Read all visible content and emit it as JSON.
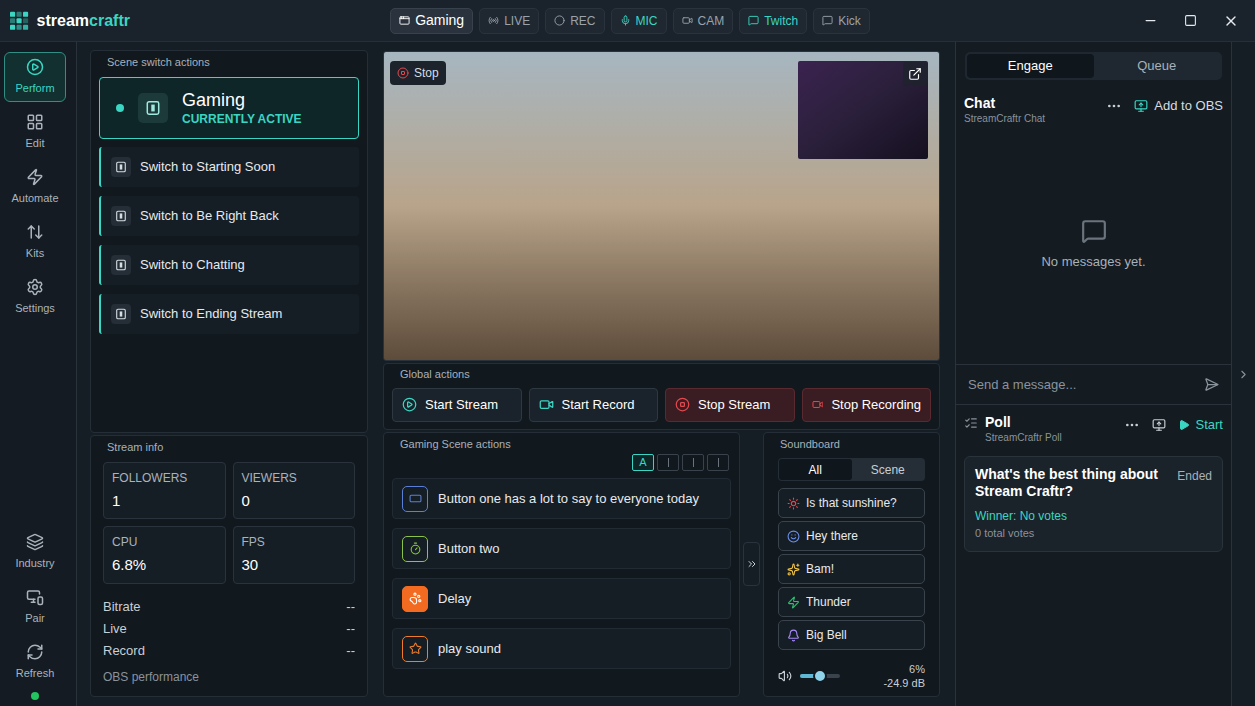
{
  "window": {
    "logo": {
      "prefix": "stream",
      "suffix": "craftr"
    }
  },
  "topbar": {
    "pills": [
      {
        "label": "Gaming",
        "selected": true,
        "on": true
      },
      {
        "label": "LIVE",
        "selected": false,
        "on": false
      },
      {
        "label": "REC",
        "selected": false,
        "on": false
      },
      {
        "label": "MIC",
        "selected": false,
        "on": true
      },
      {
        "label": "CAM",
        "selected": false,
        "on": false
      },
      {
        "label": "Twitch",
        "selected": false,
        "on": true
      },
      {
        "label": "Kick",
        "selected": false,
        "on": false
      }
    ]
  },
  "sidebar": {
    "items": [
      {
        "label": "Perform",
        "selected": true
      },
      {
        "label": "Edit",
        "selected": false
      },
      {
        "label": "Automate",
        "selected": false
      },
      {
        "label": "Kits",
        "selected": false
      },
      {
        "label": "Settings",
        "selected": false
      }
    ],
    "bottom_items": [
      {
        "label": "Industry"
      },
      {
        "label": "Pair"
      },
      {
        "label": "Refresh"
      }
    ],
    "status": {
      "connected": true,
      "color": "#22c55e"
    }
  },
  "scenes": {
    "title": "Scene switch actions",
    "active": {
      "name": "Gaming",
      "status": "CURRENTLY ACTIVE"
    },
    "items": [
      {
        "label": "Switch to Starting Soon"
      },
      {
        "label": "Switch to Be Right Back"
      },
      {
        "label": "Switch to Chatting"
      },
      {
        "label": "Switch to Ending Stream"
      }
    ]
  },
  "stream_info": {
    "title": "Stream info",
    "stats": [
      {
        "label": "FOLLOWERS",
        "value": "1"
      },
      {
        "label": "VIEWERS",
        "value": "0"
      },
      {
        "label": "CPU",
        "value": "6.8%"
      },
      {
        "label": "FPS",
        "value": "30"
      }
    ],
    "rows": [
      {
        "label": "Bitrate",
        "value": "--"
      },
      {
        "label": "Live",
        "value": "--"
      },
      {
        "label": "Record",
        "value": "--"
      }
    ],
    "footer": "OBS performance"
  },
  "preview": {
    "badge": "Stop"
  },
  "global_actions": {
    "title": "Global actions",
    "buttons": [
      {
        "label": "Start Stream",
        "kind": "start"
      },
      {
        "label": "Start Record",
        "kind": "start"
      },
      {
        "label": "Stop Stream",
        "kind": "stop"
      },
      {
        "label": "Stop Recording",
        "kind": "stop"
      }
    ]
  },
  "scene_actions": {
    "title": "Gaming Scene actions",
    "pages": [
      {
        "label": "A",
        "selected": true
      },
      {
        "selected": false
      },
      {
        "selected": false
      },
      {
        "selected": false
      }
    ],
    "buttons": [
      {
        "label": "Button one has a lot to say to everyone today",
        "color": "#5b7fd6",
        "kind": "outline"
      },
      {
        "label": "Button two",
        "color": "#8bc34a",
        "kind": "outline"
      },
      {
        "label": "Delay",
        "color": "#f26b21",
        "kind": "filled"
      },
      {
        "label": "play sound",
        "color": "#f07b2b",
        "kind": "outline"
      }
    ]
  },
  "soundboard": {
    "title": "Soundboard",
    "tabs": [
      {
        "label": "All",
        "selected": true
      },
      {
        "label": "Scene",
        "selected": false
      }
    ],
    "sounds": [
      {
        "label": "Is that sunshine?",
        "color": "#e5484d"
      },
      {
        "label": "Hey there",
        "color": "#6b8fe8"
      },
      {
        "label": "Bam!",
        "color": "#f5c542"
      },
      {
        "label": "Thunder",
        "color": "#2fbf71"
      },
      {
        "label": "Big Bell",
        "color": "#a78bfa"
      }
    ],
    "volume": {
      "level": 0.5,
      "percent": "6%",
      "reading": "-24.9 dB"
    }
  },
  "engage": {
    "tabs": [
      {
        "label": "Engage",
        "selected": true
      },
      {
        "label": "Queue",
        "selected": false
      }
    ],
    "chat": {
      "title": "Chat",
      "subtitle": "StreamCraftr Chat",
      "action": "Add to OBS",
      "empty": "No messages yet.",
      "input_placeholder": "Send a message..."
    },
    "poll": {
      "title": "Poll",
      "subtitle": "StreamCraftr Poll",
      "action": "Start",
      "question": "What's the best thing about Stream Craftr?",
      "status": "Ended",
      "winner": "Winner: No votes",
      "votes": "0 total votes"
    }
  }
}
